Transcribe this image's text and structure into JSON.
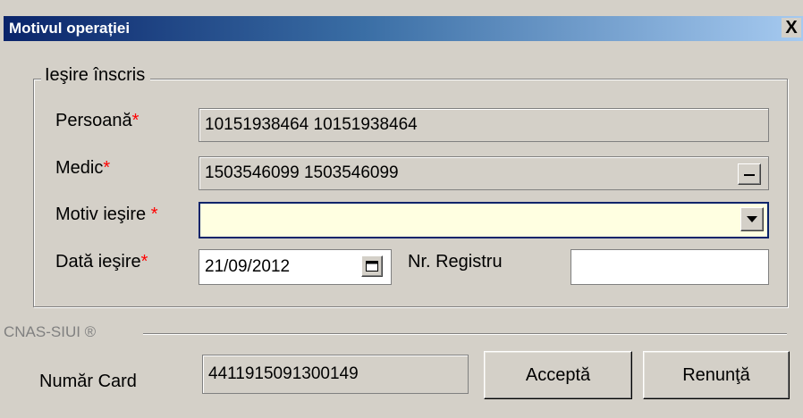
{
  "window": {
    "title": "Motivul operației",
    "close_label": "X"
  },
  "group": {
    "legend": "Ieşire înscris",
    "persoana": {
      "label": "Persoană",
      "required": "*",
      "value": "10151938464 10151938464"
    },
    "medic": {
      "label": "Medic",
      "required": "*",
      "value": "1503546099 1503546099",
      "button_label": "..."
    },
    "motiv": {
      "label": "Motiv ieşire ",
      "required": "*",
      "value": ""
    },
    "data": {
      "label": "Dată ieşire",
      "required": "*",
      "value": "21/09/2012"
    },
    "registru": {
      "label": "Nr. Registru",
      "value": ""
    }
  },
  "footer": {
    "separator_label": "CNAS-SIUI ®",
    "card_label": "Număr Card",
    "card_value": "4411915091300149",
    "accept_label": "Acceptă",
    "cancel_label": "Renunţă"
  },
  "colors": {
    "window_bg": "#d4d0c8",
    "title_gradient_start": "#0a246a",
    "title_gradient_end": "#a6caf0",
    "required_mark": "#ff0000",
    "combo_bg": "#ffffe1"
  },
  "icons": {
    "medic_button": "ellipsis-icon",
    "combo": "dropdown-arrow-icon",
    "date_picker": "calendar-icon"
  }
}
